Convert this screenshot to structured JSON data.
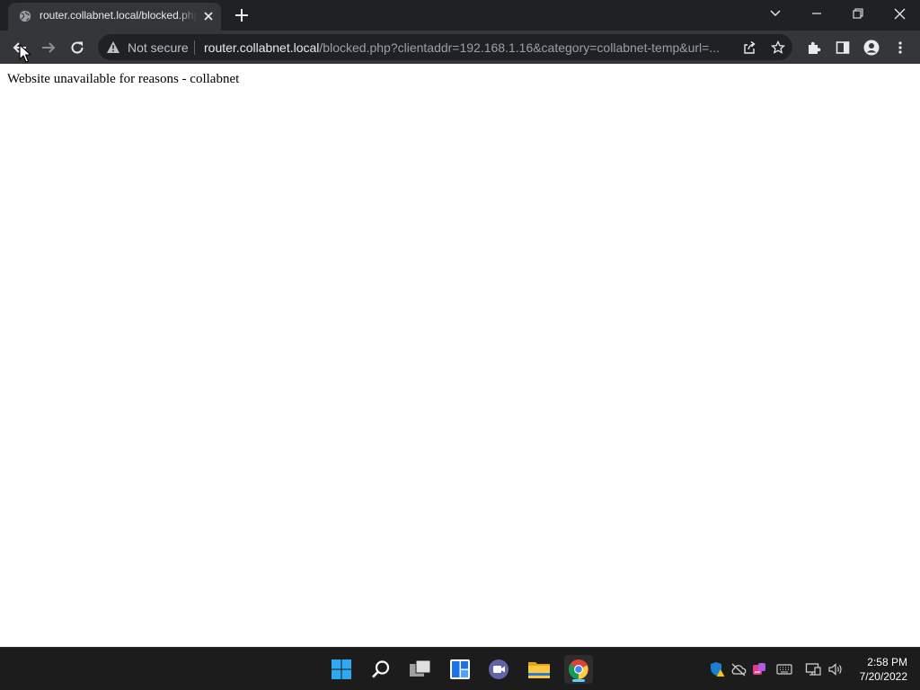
{
  "browser": {
    "tab": {
      "title": "router.collabnet.local/blocked.php?clientaddr=192.168.1.16&category=collabnet-temp&url=..."
    },
    "omnibox": {
      "security_label": "Not secure",
      "url_host": "router.collabnet.local",
      "url_path": "/blocked.php?clientaddr=192.168.1.16&category=collabnet-temp&url=..."
    }
  },
  "page": {
    "message": "Website unavailable for reasons - collabnet"
  },
  "taskbar": {
    "clock": {
      "time": "2:58 PM",
      "date": "7/20/2022"
    }
  },
  "colors": {
    "tabstrip_bg": "#202124",
    "toolbar_bg": "#35363a",
    "taskbar_bg": "#1c1c1c",
    "accent": "#60cdff"
  }
}
